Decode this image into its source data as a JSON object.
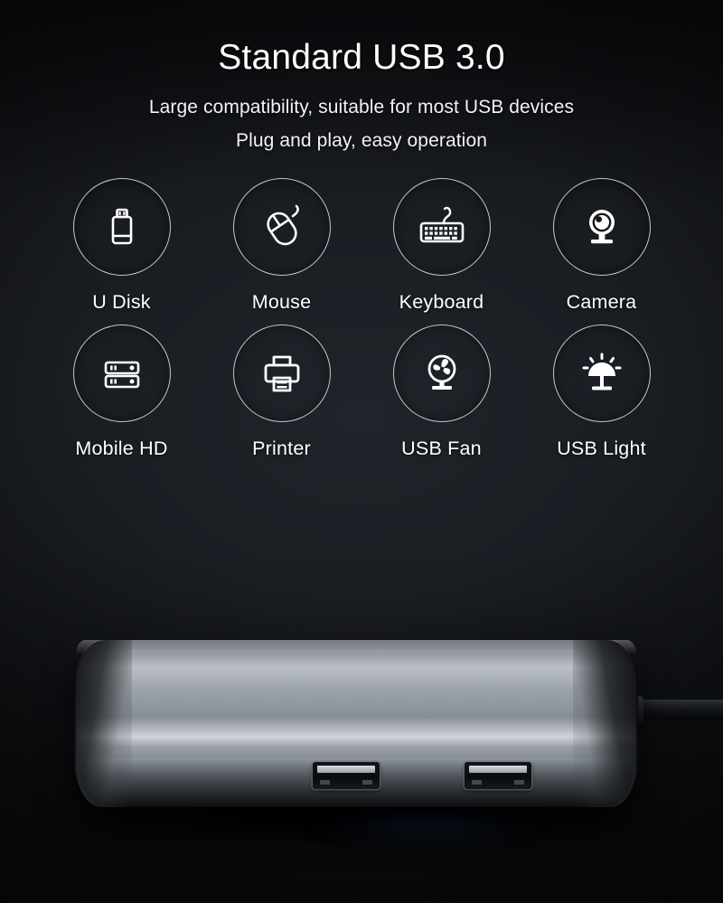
{
  "page": {
    "headline": "Standard USB 3.0",
    "subline_1": "Large compatibility, suitable for most USB devices",
    "subline_2": "Plug and play, easy operation"
  },
  "colors": {
    "background": "#14161b",
    "background_center": "#20242a",
    "text": "#ffffff",
    "circle_stroke": "#c3c8cd",
    "icon": "#ffffff",
    "product_silver": "#b9bfc5",
    "product_dark": "#2b2f34",
    "glow_blue": "#244a84"
  },
  "devices": [
    {
      "label": "U Disk",
      "icon": "usb-flash-drive-icon"
    },
    {
      "label": "Mouse",
      "icon": "computer-mouse-icon"
    },
    {
      "label": "Keyboard",
      "icon": "keyboard-icon"
    },
    {
      "label": "Camera",
      "icon": "webcam-icon"
    },
    {
      "label": "Mobile HD",
      "icon": "external-hard-drive-icon"
    },
    {
      "label": "Printer",
      "icon": "printer-icon"
    },
    {
      "label": "USB Fan",
      "icon": "desk-fan-icon"
    },
    {
      "label": "USB Light",
      "icon": "desk-lamp-icon"
    }
  ],
  "product": {
    "name": "usb-hub-photo",
    "ports": [
      "usb-a-port-1",
      "usb-a-port-2"
    ],
    "cable": "usb-cable"
  }
}
